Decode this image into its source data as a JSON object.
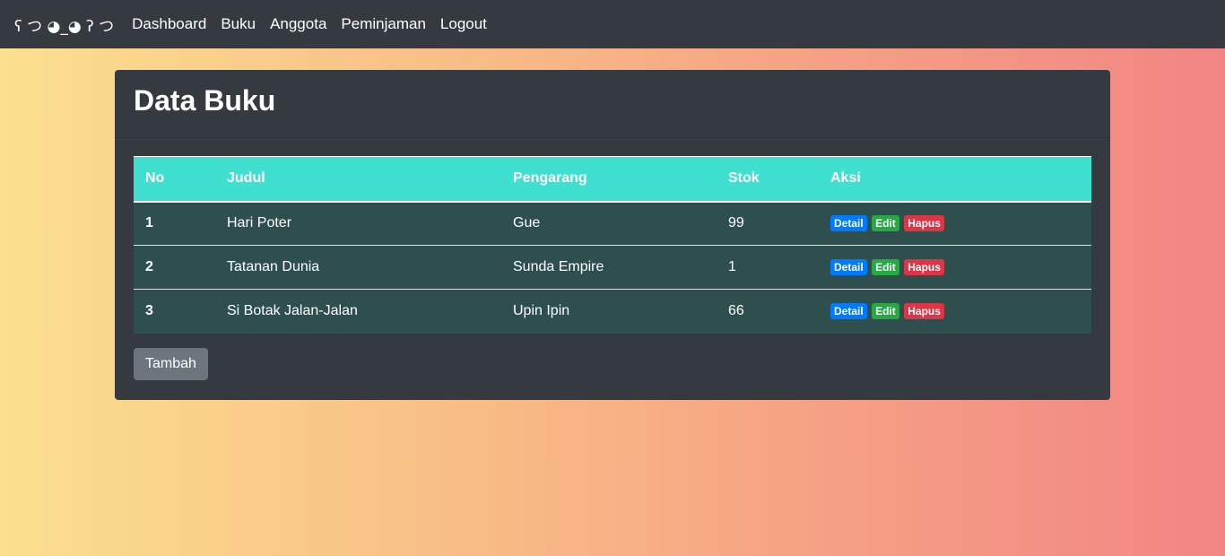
{
  "navbar": {
    "brand": "ʕ つ ◕_◕ ʔ つ",
    "links": [
      "Dashboard",
      "Buku",
      "Anggota",
      "Peminjaman",
      "Logout"
    ]
  },
  "card": {
    "title": "Data Buku",
    "table": {
      "headers": [
        "No",
        "Judul",
        "Pengarang",
        "Stok",
        "Aksi"
      ],
      "rows": [
        {
          "no": "1",
          "judul": "Hari Poter",
          "pengarang": "Gue",
          "stok": "99"
        },
        {
          "no": "2",
          "judul": "Tatanan Dunia",
          "pengarang": "Sunda Empire",
          "stok": "1"
        },
        {
          "no": "3",
          "judul": "Si Botak Jalan-Jalan",
          "pengarang": "Upin Ipin",
          "stok": "66"
        }
      ],
      "actions": {
        "detail": "Detail",
        "edit": "Edit",
        "hapus": "Hapus"
      }
    },
    "add_button": "Tambah"
  },
  "colors": {
    "navbar_bg": "#343a40",
    "table_header_bg": "#40e0d0",
    "table_row_bg": "#2f4f4f",
    "detail": "#007bff",
    "edit": "#28a745",
    "hapus": "#dc3545",
    "button_secondary": "#6c757d"
  }
}
